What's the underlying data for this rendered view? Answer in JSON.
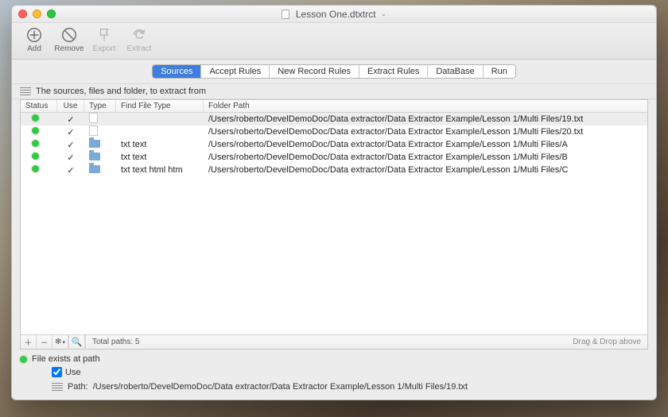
{
  "window": {
    "title": "Lesson One.dtxtrct"
  },
  "toolbar": {
    "add": {
      "label": "Add"
    },
    "remove": {
      "label": "Remove"
    },
    "export": {
      "label": "Export"
    },
    "extract": {
      "label": "Extract"
    }
  },
  "tabs": [
    {
      "label": "Sources",
      "active": true
    },
    {
      "label": "Accept Rules",
      "active": false
    },
    {
      "label": "New Record Rules",
      "active": false
    },
    {
      "label": "Extract Rules",
      "active": false
    },
    {
      "label": "DataBase",
      "active": false
    },
    {
      "label": "Run",
      "active": false
    }
  ],
  "subhead": "The sources, files and folder, to extract from",
  "columns": {
    "status": "Status",
    "use": "Use",
    "type": "Type",
    "fft": "Find File Type",
    "path": "Folder Path"
  },
  "rows": [
    {
      "status": "ok",
      "use": true,
      "type": "file",
      "fft": "",
      "path": "/Users/roberto/DevelDemoDoc/Data extractor/Data Extractor Example/Lesson 1/Multi Files/19.txt",
      "selected": true
    },
    {
      "status": "ok",
      "use": true,
      "type": "file",
      "fft": "",
      "path": "/Users/roberto/DevelDemoDoc/Data extractor/Data Extractor Example/Lesson 1/Multi Files/20.txt"
    },
    {
      "status": "ok",
      "use": true,
      "type": "folder",
      "fft": "txt text",
      "path": "/Users/roberto/DevelDemoDoc/Data extractor/Data Extractor Example/Lesson 1/Multi Files/A"
    },
    {
      "status": "ok",
      "use": true,
      "type": "folder",
      "fft": "txt text",
      "path": "/Users/roberto/DevelDemoDoc/Data extractor/Data Extractor Example/Lesson 1/Multi Files/B"
    },
    {
      "status": "ok",
      "use": true,
      "type": "folder",
      "fft": "txt text html htm",
      "path": "/Users/roberto/DevelDemoDoc/Data extractor/Data Extractor Example/Lesson 1/Multi Files/C"
    }
  ],
  "footer": {
    "total_label": "Total paths: 5",
    "drop_hint": "Drag & Drop above"
  },
  "detail": {
    "header": "File exists at path",
    "use_label": "Use",
    "use_checked": true,
    "path_label": "Path:",
    "path_value": "/Users/roberto/DevelDemoDoc/Data extractor/Data Extractor Example/Lesson 1/Multi Files/19.txt"
  }
}
